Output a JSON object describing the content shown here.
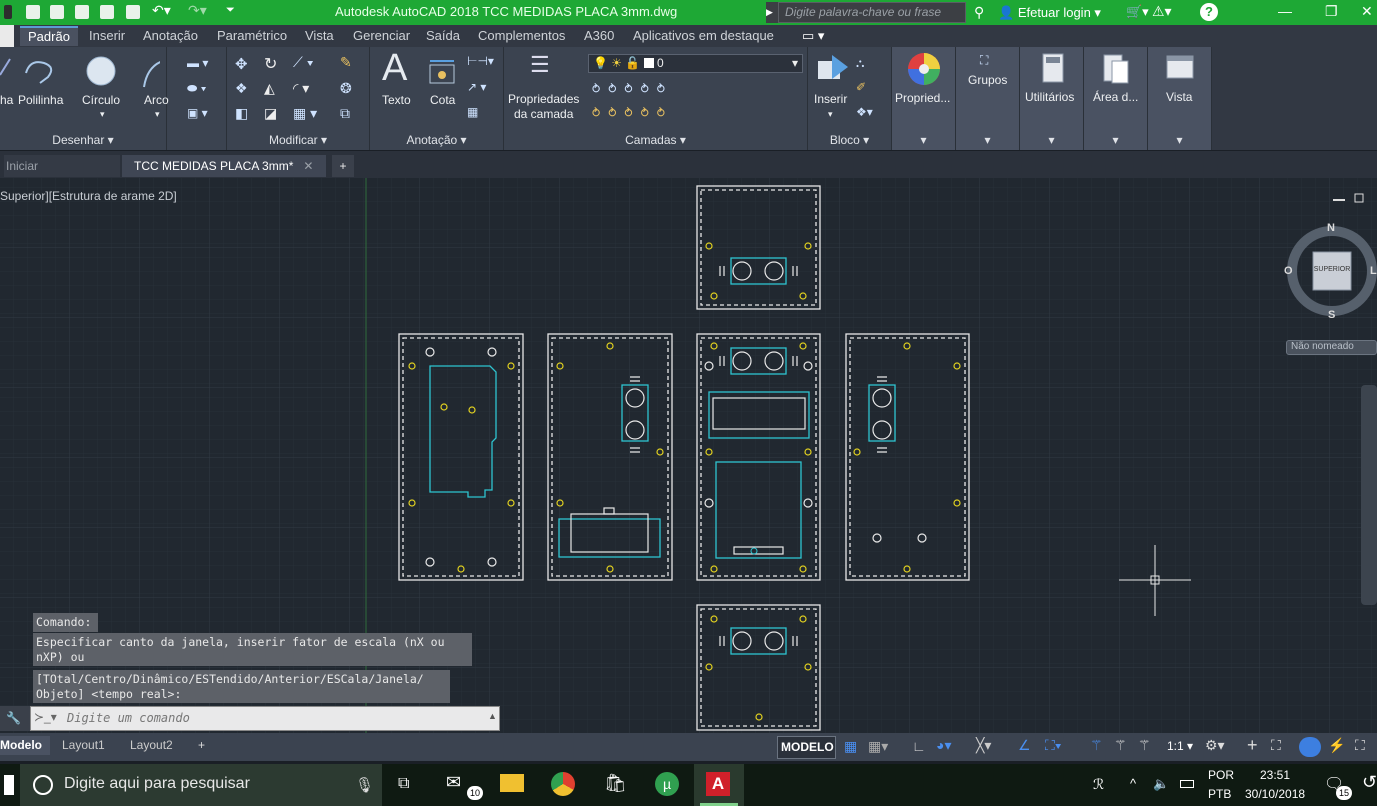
{
  "titlebar": {
    "title": "Autodesk AutoCAD 2018    TCC MEDIDAS PLACA 3mm.dwg",
    "search_placeholder": "Digite palavra-chave ou frase",
    "login": "Efetuar login",
    "accent": "#1ea835"
  },
  "ribbon_tabs": [
    "Padrão",
    "Inserir",
    "Anotação",
    "Paramétrico",
    "Vista",
    "Gerenciar",
    "Saída",
    "Complementos",
    "A360",
    "Aplicativos em destaque"
  ],
  "ribbon": {
    "draw_tools": [
      "Polilinha",
      "Círculo",
      "Arco"
    ],
    "draw_clipped": "ha",
    "panel_draw": "Desenhar ▾",
    "panel_modify": "Modificar ▾",
    "annotation_tools": [
      "Texto",
      "Cota"
    ],
    "panel_annotation": "Anotação ▾",
    "layer_props": "Propriedades\nda camada",
    "layer_current": "0",
    "panel_layers": "Camadas ▾",
    "insert": "Inserir",
    "panel_block": "Bloco ▾",
    "properties": "Propried...",
    "groups": "Grupos",
    "utilities": "Utilitários",
    "clipboard": "Área d...",
    "view": "Vista"
  },
  "doc_tabs": {
    "start": "Iniciar",
    "active": "TCC MEDIDAS PLACA 3mm*"
  },
  "viewport": {
    "label": "Superior][Estrutura de arame 2D]",
    "viewcube": {
      "n": "N",
      "s": "S",
      "w": "O",
      "e": "L",
      "face": "SUPERIOR"
    },
    "ucs": "Não nomeado"
  },
  "command": {
    "line1": "Comando:",
    "line2": "Especificar canto da janela, inserir fator de escala (nX ou nXP) ou",
    "line3": "[TOtal/Centro/Dinâmico/ESTendido/Anterior/ESCala/Janela/ Objeto] <tempo real>:",
    "placeholder": "Digite um comando"
  },
  "layout_tabs": [
    "Modelo",
    "Layout1",
    "Layout2"
  ],
  "status": {
    "model": "MODELO",
    "scale": "1:1"
  },
  "taskbar": {
    "search": "Digite aqui para pesquisar",
    "lang1": "POR",
    "lang2": "PTB",
    "time": "23:51",
    "date": "30/10/2018",
    "mail_badge": "10",
    "notif_badge": "15"
  }
}
